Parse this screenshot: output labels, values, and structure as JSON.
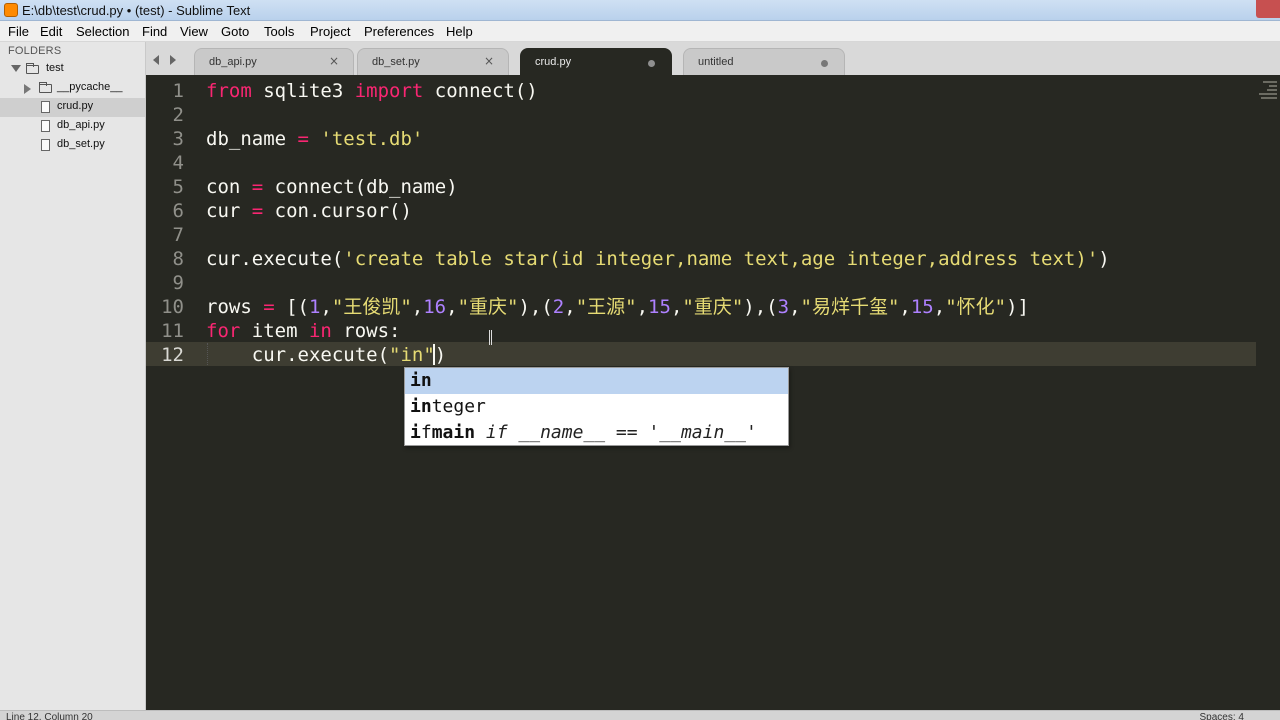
{
  "window": {
    "title": "E:\\db\\test\\crud.py • (test) - Sublime Text"
  },
  "menu": [
    "File",
    "Edit",
    "Selection",
    "Find",
    "View",
    "Goto",
    "Tools",
    "Project",
    "Preferences",
    "Help"
  ],
  "sidebar": {
    "header": "FOLDERS",
    "root_folder": "test",
    "subfolder": "__pycache__",
    "files": [
      "crud.py",
      "db_api.py",
      "db_set.py"
    ],
    "selected_file": "crud.py"
  },
  "tabs": [
    {
      "label": "db_api.py",
      "state": "close"
    },
    {
      "label": "db_set.py",
      "state": "close"
    },
    {
      "label": "crud.py",
      "state": "modified",
      "active": true
    },
    {
      "label": "untitled",
      "state": "modified"
    }
  ],
  "tab_close_glyph": "×",
  "editor": {
    "line_numbers": [
      "1",
      "2",
      "3",
      "4",
      "5",
      "6",
      "7",
      "8",
      "9",
      "10",
      "11",
      "12"
    ],
    "current_line": "12",
    "code": [
      "from sqlite3 import connect()",
      "",
      "db_name = 'test.db'",
      "",
      "con = connect(db_name)",
      "cur = con.cursor()",
      "",
      "cur.execute('create table star(id integer,name text,age integer,address text)')",
      "",
      "rows = [(1,\"王俊凯\",16,\"重庆\"),(2,\"王源\",15,\"重庆\"),(3,\"易烊千玺\",15,\"怀化\")]",
      "for item in rows:",
      "    cur.execute(\"in\")"
    ]
  },
  "autocomplete": {
    "items": [
      {
        "match": "in",
        "rest": "",
        "hint": ""
      },
      {
        "match": "in",
        "rest": "teger",
        "hint": ""
      },
      {
        "match": "i",
        "mid": "f",
        "match2": "main",
        "hint": " if __name__ == '__main__'"
      }
    ]
  },
  "status": {
    "left": "Line 12, Column 20",
    "right": "Spaces: 4"
  },
  "colors": {
    "editor_bg": "#272822",
    "keyword": "#f92672",
    "string": "#e6db74",
    "number": "#ae81ff",
    "text": "#f8f8f2",
    "selection_row": "#bcd3f0"
  }
}
